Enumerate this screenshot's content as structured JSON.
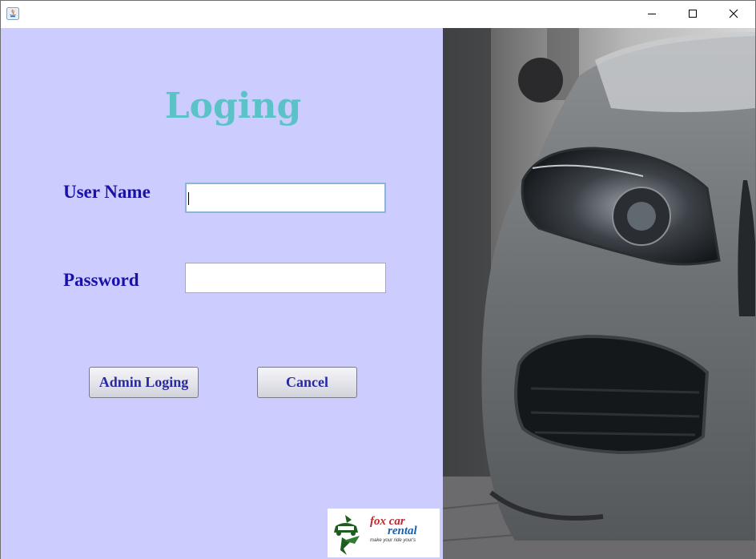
{
  "window": {
    "controls": {
      "minimize_icon": "minimize-icon",
      "maximize_icon": "maximize-icon",
      "close_icon": "close-icon"
    }
  },
  "form": {
    "title": "Loging",
    "username_label": "User Name",
    "username_value": "",
    "password_label": "Password",
    "password_value": "",
    "admin_button": "Admin Loging",
    "cancel_button": "Cancel"
  },
  "logo": {
    "line1": "fox car",
    "line2": "rental",
    "tagline": "make your ride your's"
  },
  "colors": {
    "panel_bg": "#ccccff",
    "title": "#5bc3c7",
    "label": "#1a12a8",
    "button_text": "#2a2aa0"
  }
}
